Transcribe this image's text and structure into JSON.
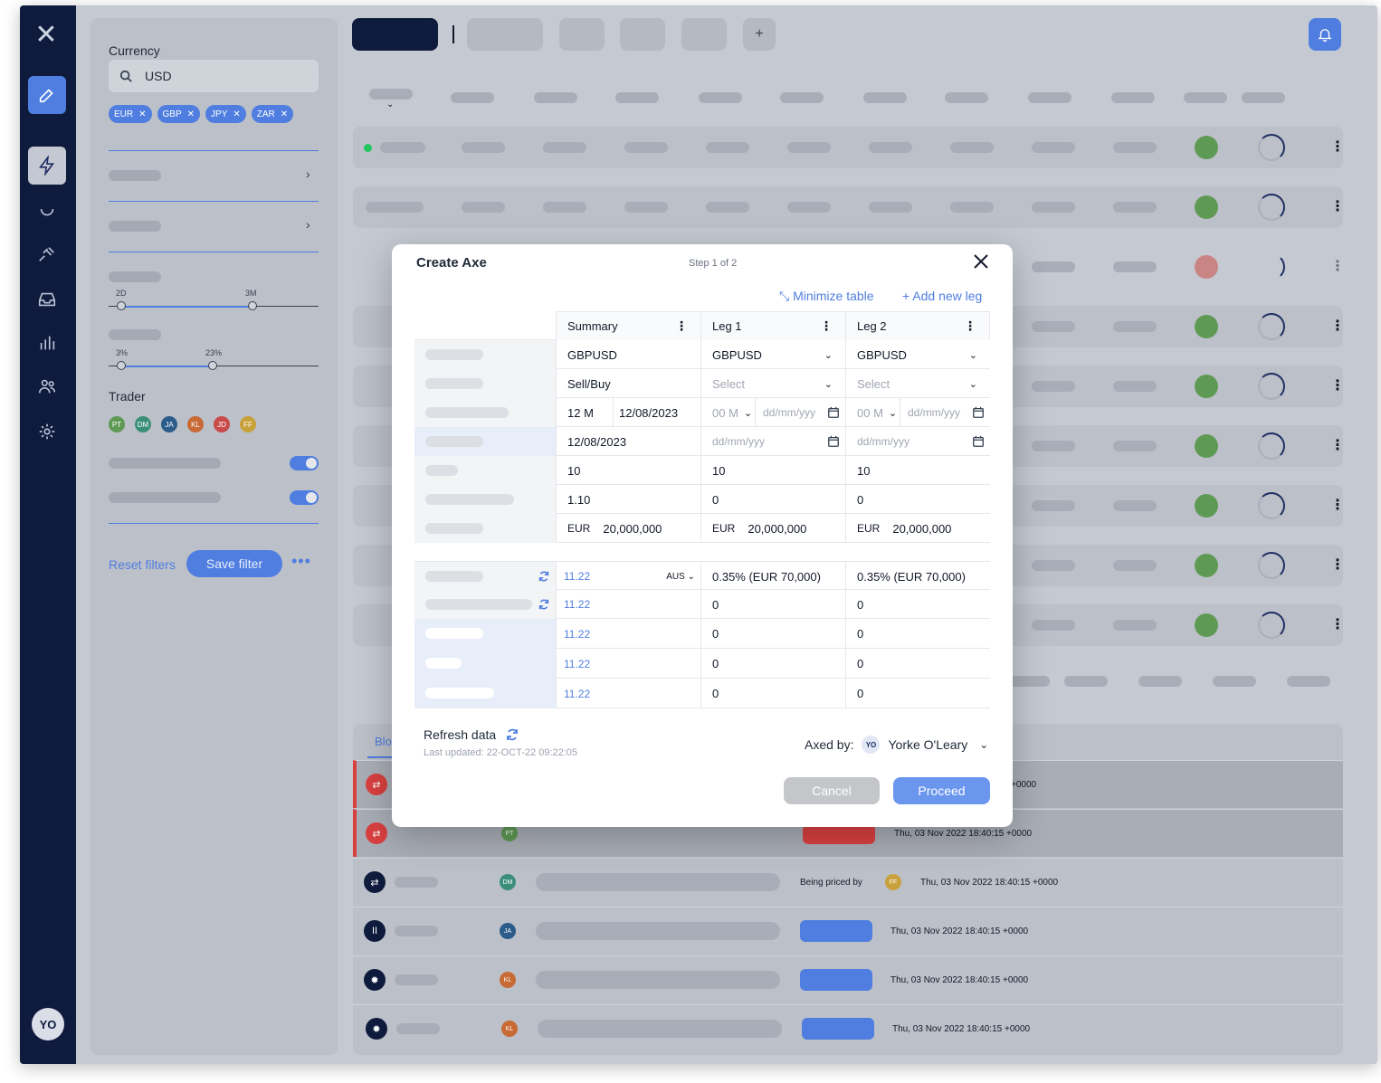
{
  "rail": {
    "user_initials": "YO"
  },
  "filters": {
    "currency_label": "Currency",
    "search_value": "USD",
    "chips": [
      "EUR",
      "GBP",
      "JPY",
      "ZAR"
    ],
    "slider1": {
      "min_label": "2D",
      "max_label": "3M"
    },
    "slider2": {
      "min_label": "3%",
      "max_label": "23%"
    },
    "trader_label": "Trader",
    "traders": [
      {
        "initials": "PT",
        "color": "#5f9a55"
      },
      {
        "initials": "DM",
        "color": "#3b8f7a"
      },
      {
        "initials": "JA",
        "color": "#2b5c8a"
      },
      {
        "initials": "KL",
        "color": "#c76a35"
      },
      {
        "initials": "JD",
        "color": "#c94a4a"
      },
      {
        "initials": "FF",
        "color": "#c9a13b"
      }
    ],
    "reset_label": "Reset filters",
    "save_label": "Save filter"
  },
  "topbar": {
    "add_label": "+"
  },
  "bottom_panel": {
    "tab_label": "Blo",
    "rows": [
      {
        "initials": "PT",
        "timestamp": "Thu, 03 Nov 2022 18:40:15 +0000",
        "status": ""
      },
      {
        "initials": "DM",
        "timestamp": "Thu, 03 Nov 2022 18:40:15 +0000",
        "status": "Being priced by",
        "status_initials": "FF"
      },
      {
        "initials": "JA",
        "timestamp": "Thu, 03 Nov 2022 18:40:15 +0000",
        "status": ""
      },
      {
        "initials": "KL",
        "timestamp": "Thu, 03 Nov 2022 18:40:15 +0000",
        "status": ""
      },
      {
        "initials": "KL",
        "timestamp": "Thu, 03 Nov 2022 18:40:15 +0000",
        "status": ""
      }
    ],
    "first_row_suffix": "+0000"
  },
  "modal": {
    "title": "Create Axe",
    "step": "Step 1 of 2",
    "minimize_label": "Minimize table",
    "add_leg_label": "+ Add new leg",
    "columns": [
      "Summary",
      "Leg 1",
      "Leg 2"
    ],
    "rows": {
      "pair": [
        "GBPUSD",
        "GBPUSD",
        "GBPUSD"
      ],
      "side": [
        "Sell/Buy",
        "Select",
        "Select"
      ],
      "tenor": {
        "summary_tenor": "12 M",
        "summary_date": "12/08/2023",
        "leg_tenor_placeholder": "00 M",
        "leg_date_placeholder": "dd/mm/yyy"
      },
      "date": [
        "12/08/2023",
        "dd/mm/yyy",
        "dd/mm/yyy"
      ],
      "qty": [
        "10",
        "10",
        "10"
      ],
      "rate": [
        "1.10",
        "0",
        "0"
      ],
      "notional": {
        "currency": "EUR",
        "values": [
          "20,000,000",
          "20,000,000",
          "20,000,000"
        ]
      }
    },
    "price_rows": [
      {
        "summary": "11.22",
        "unit": "AUS",
        "leg1": "0.35% (EUR 70,000)",
        "leg2": "0.35% (EUR 70,000)"
      },
      {
        "summary": "11.22",
        "leg1": "0",
        "leg2": "0"
      },
      {
        "summary": "11.22",
        "leg1": "0",
        "leg2": "0"
      },
      {
        "summary": "11.22",
        "leg1": "0",
        "leg2": "0"
      },
      {
        "summary": "11.22",
        "leg1": "0",
        "leg2": "0"
      }
    ],
    "refresh_label": "Refresh data",
    "last_updated": "Last updated: 22-OCT-22 09:22:05",
    "axed_by_label": "Axed by:",
    "axed_by_initials": "YO",
    "axed_by_name": "Yorke O'Leary",
    "cancel_label": "Cancel",
    "proceed_label": "Proceed"
  },
  "colors": {
    "accent": "#4f7ee0",
    "rail": "#0f1b3d",
    "status_green": "#5f9a55",
    "status_red": "#c98484"
  }
}
